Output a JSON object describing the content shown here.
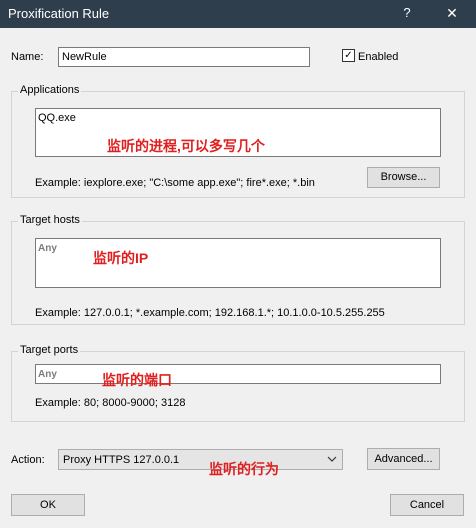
{
  "window": {
    "title": "Proxification Rule",
    "help_label": "?",
    "close_label": "✕"
  },
  "name": {
    "label": "Name:",
    "value": "NewRule"
  },
  "enabled": {
    "label": "Enabled",
    "checked": true,
    "checkmark": "✓"
  },
  "applications": {
    "title": "Applications",
    "value": "QQ.exe",
    "example": "Example: iexplore.exe; \"C:\\some app.exe\"; fire*.exe; *.bin",
    "browse_label": "Browse...",
    "annotation": "监听的进程,可以多写几个"
  },
  "target_hosts": {
    "title": "Target hosts",
    "value": "Any",
    "example": "Example: 127.0.0.1; *.example.com; 192.168.1.*; 10.1.0.0-10.5.255.255",
    "annotation": "监听的IP"
  },
  "target_ports": {
    "title": "Target ports",
    "value": "Any",
    "example": "Example: 80; 8000-9000; 3128",
    "annotation": "监听的端口"
  },
  "action": {
    "label": "Action:",
    "selected": "Proxy HTTPS 127.0.0.1",
    "advanced_label": "Advanced...",
    "annotation": "监听的行为"
  },
  "footer": {
    "ok_label": "OK",
    "cancel_label": "Cancel"
  },
  "colors": {
    "titlebar": "#2f3e4d",
    "annotation": "#e02020"
  }
}
